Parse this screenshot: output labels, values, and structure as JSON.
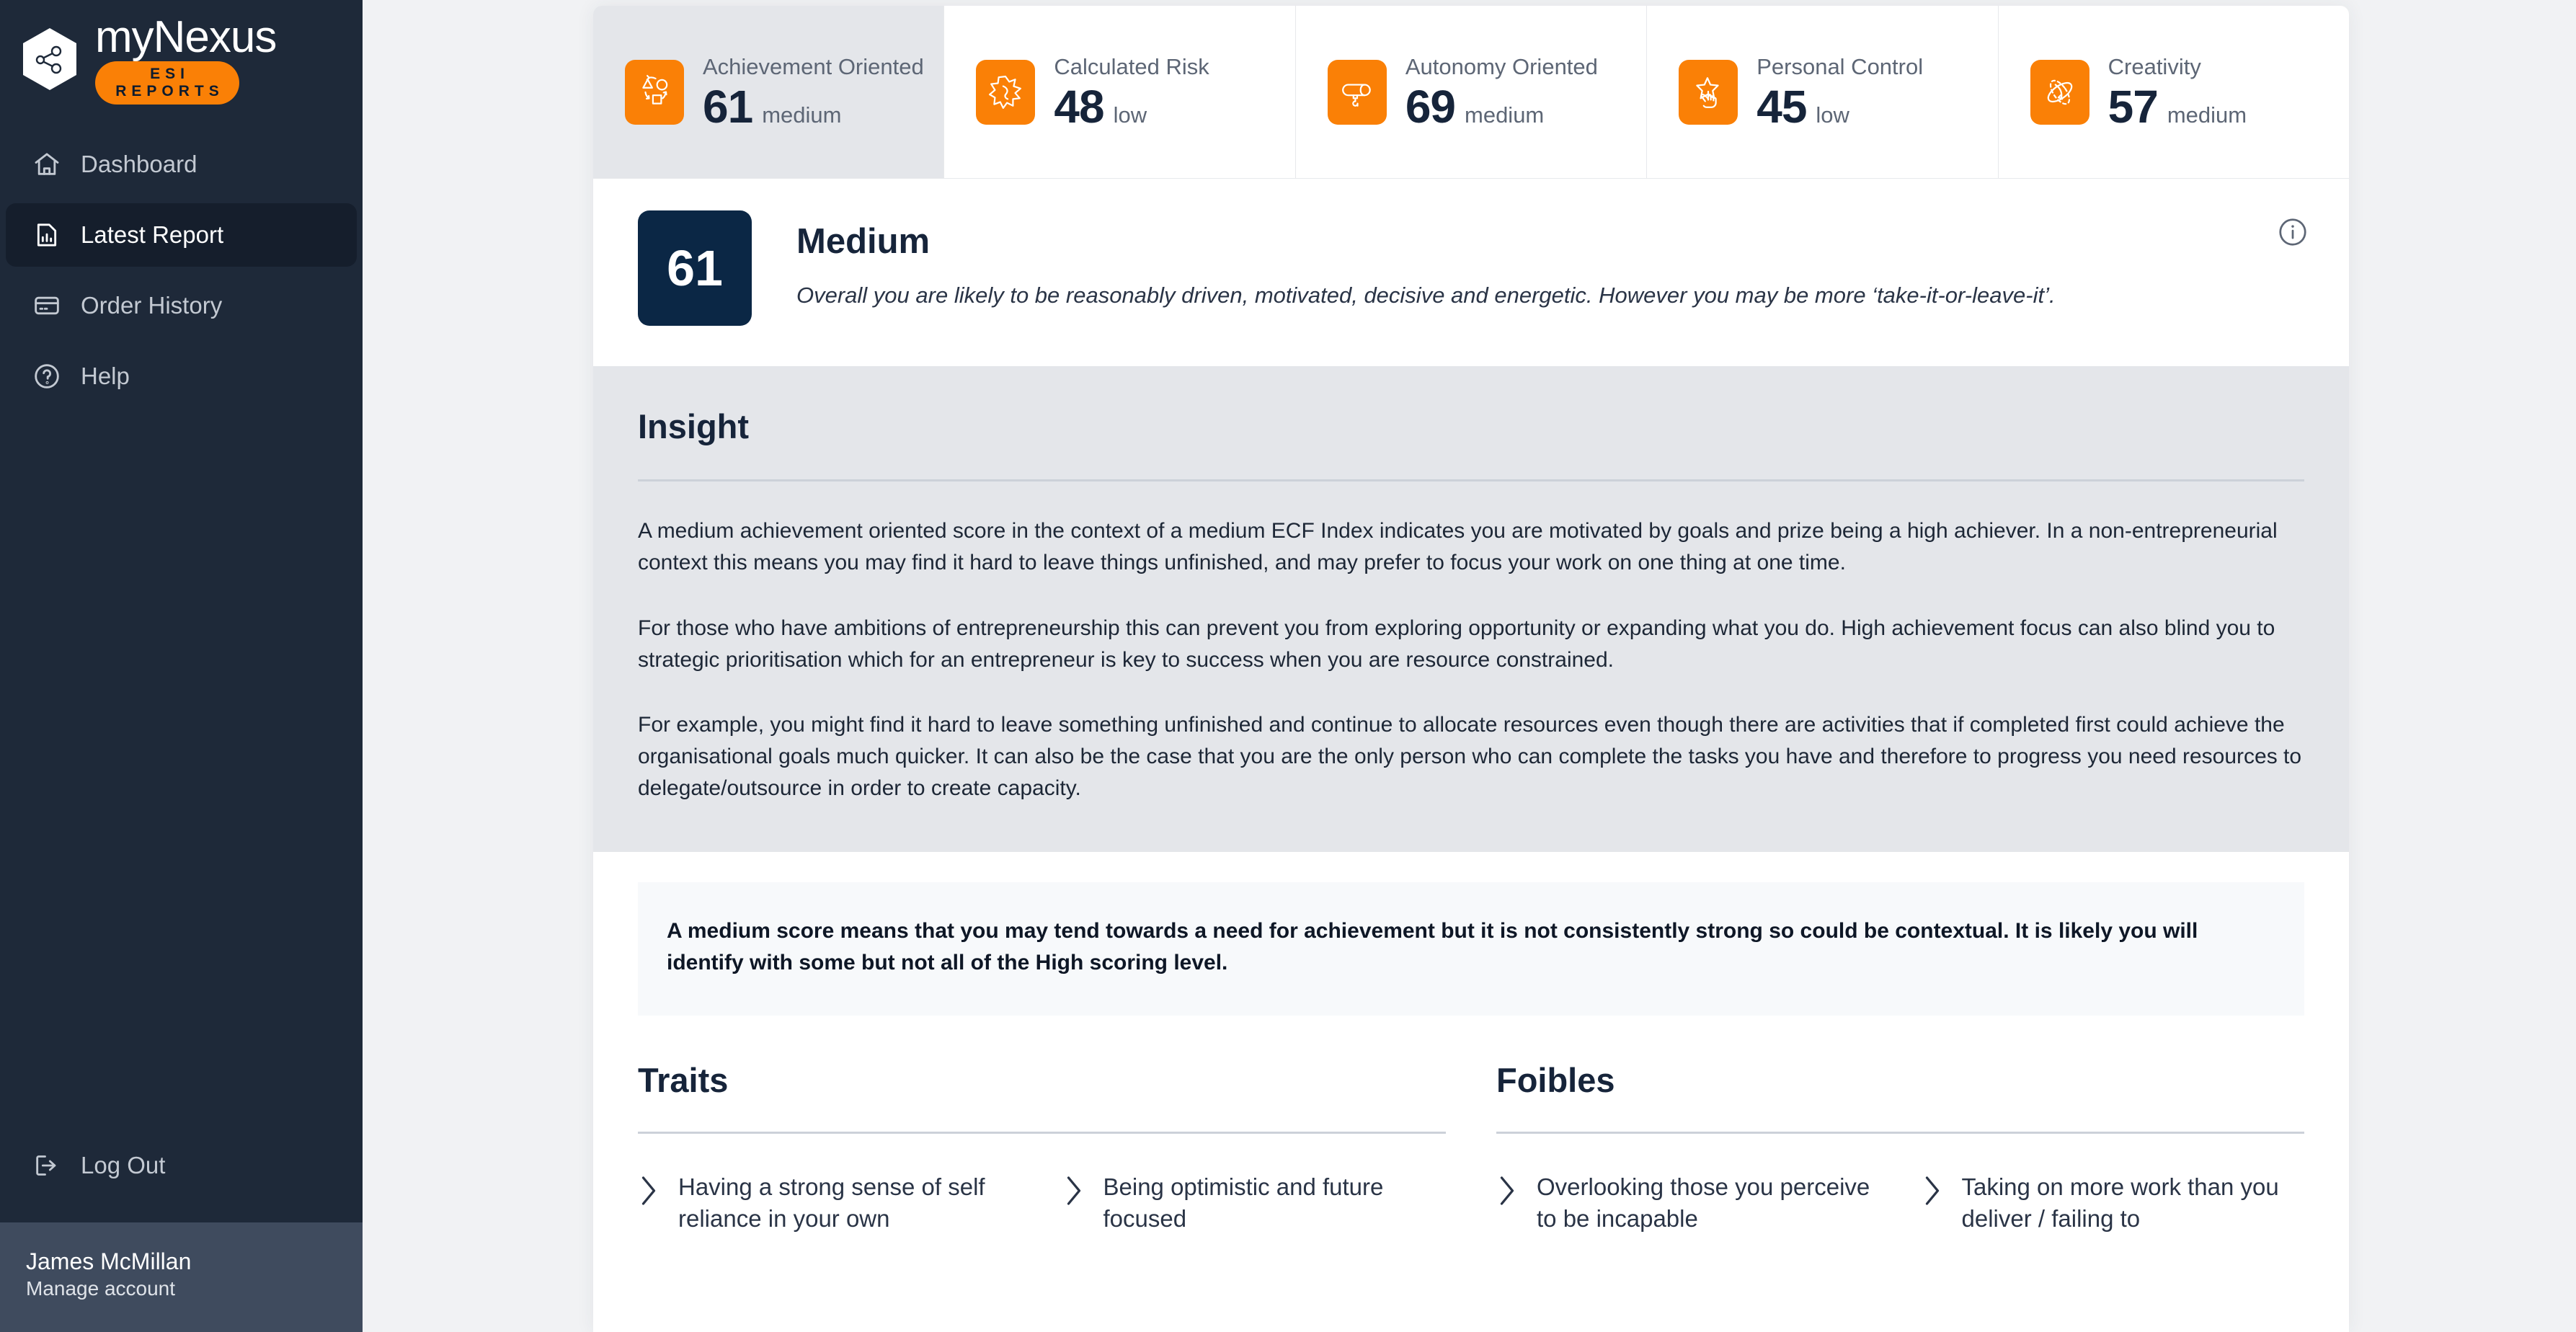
{
  "brand": {
    "name": "myNexus",
    "tagline": "ESI REPORTS"
  },
  "sidebar": {
    "items": [
      {
        "label": "Dashboard",
        "icon": "home-icon",
        "active": false
      },
      {
        "label": "Latest Report",
        "icon": "report-icon",
        "active": true
      },
      {
        "label": "Order History",
        "icon": "card-icon",
        "active": false
      },
      {
        "label": "Help",
        "icon": "question-icon",
        "active": false
      }
    ],
    "logout": {
      "label": "Log Out",
      "icon": "logout-icon"
    },
    "user": {
      "name": "James McMillan",
      "subtitle": "Manage account"
    }
  },
  "cards": [
    {
      "title": "Achievement Oriented",
      "score": "61",
      "band": "medium",
      "icon": "shapes-cycle-icon",
      "active": true
    },
    {
      "title": "Calculated Risk",
      "score": "48",
      "band": "low",
      "icon": "burst-icon",
      "active": false
    },
    {
      "title": "Autonomy Oriented",
      "score": "69",
      "band": "medium",
      "icon": "megaphone-icon",
      "active": false
    },
    {
      "title": "Personal Control",
      "score": "45",
      "band": "low",
      "icon": "star-hand-icon",
      "active": false
    },
    {
      "title": "Creativity",
      "score": "57",
      "band": "medium",
      "icon": "atom-icon",
      "active": false
    }
  ],
  "banner": {
    "score": "61",
    "band": "Medium",
    "description": "Overall you are likely to be reasonably driven, motivated, decisive and energetic. However you may be more ‘take-it-or-leave-it’.",
    "info_icon": "info-icon"
  },
  "insight": {
    "title": "Insight",
    "paragraphs": [
      "A medium achievement oriented score in the context of a medium ECF Index indicates you are motivated by goals and prize being a high achiever. In a non-entrepreneurial context this means you may find it hard to leave things unfinished, and may prefer to focus your work on one thing at one time.",
      "For those who have ambitions of entrepreneurship this can prevent you from exploring opportunity or expanding what you do. High achievement focus can also blind you to strategic prioritisation which for an entrepreneur is key to success when you are resource constrained.",
      "For example, you might find it hard to leave something unfinished and continue to allocate resources even though there are activities that if completed first could achieve the organisational goals much quicker. It can also be the case that you are the only person who can complete the tasks you have and therefore to progress you need resources to delegate/outsource in order to create capacity."
    ]
  },
  "callout": {
    "text": "A medium score means that you may tend towards a need for achievement but it is not consistently strong so could be contextual. It is likely you will identify with some but not all of the High scoring level."
  },
  "traits": {
    "title": "Traits",
    "items": [
      "Having a strong sense of self reliance in your own",
      "Being optimistic and future focused"
    ]
  },
  "foibles": {
    "title": "Foibles",
    "items": [
      "Overlooking those you perceive to be incapable",
      "Taking on more work than you deliver / failing to"
    ]
  },
  "colors": {
    "accent": "#fa8006",
    "sidebar": "#1e2939",
    "sidebar_active": "#151e2c",
    "score_badge": "#0b2745",
    "insight_bg": "#e4e6ea",
    "text_dark": "#16243a"
  }
}
